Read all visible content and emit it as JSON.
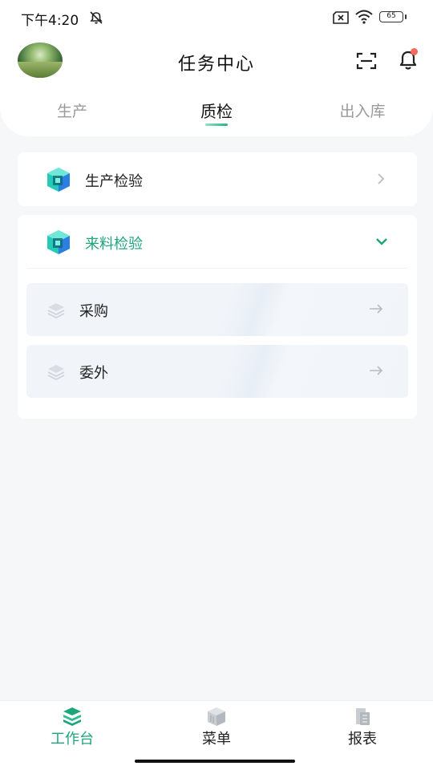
{
  "status_bar": {
    "time": "下午4:20",
    "battery": "65"
  },
  "header": {
    "title": "任务中心",
    "icons": [
      "avatar",
      "scan-icon",
      "bell-icon"
    ],
    "notification_dot_color": "#f46a5c"
  },
  "tabs": [
    {
      "label": "生产",
      "active": false
    },
    {
      "label": "质检",
      "active": true
    },
    {
      "label": "出入库",
      "active": false
    }
  ],
  "sections": [
    {
      "label": "生产检验",
      "expanded": false,
      "icon": "cube-icon"
    },
    {
      "label": "来料检验",
      "expanded": true,
      "icon": "cube-icon",
      "items": [
        {
          "label": "采购",
          "icon": "layers-icon"
        },
        {
          "label": "委外",
          "icon": "layers-icon"
        }
      ]
    }
  ],
  "bottom_nav": [
    {
      "label": "工作台",
      "active": true,
      "icon": "workbench-icon"
    },
    {
      "label": "菜单",
      "active": false,
      "icon": "menu-icon"
    },
    {
      "label": "报表",
      "active": false,
      "icon": "report-icon"
    }
  ],
  "colors": {
    "accent": "#1fa57b",
    "background": "#f6f7f8",
    "card": "#ffffff",
    "sub_item_bg": "#f1f5fa",
    "inactive_tab": "#9a9a9a"
  }
}
